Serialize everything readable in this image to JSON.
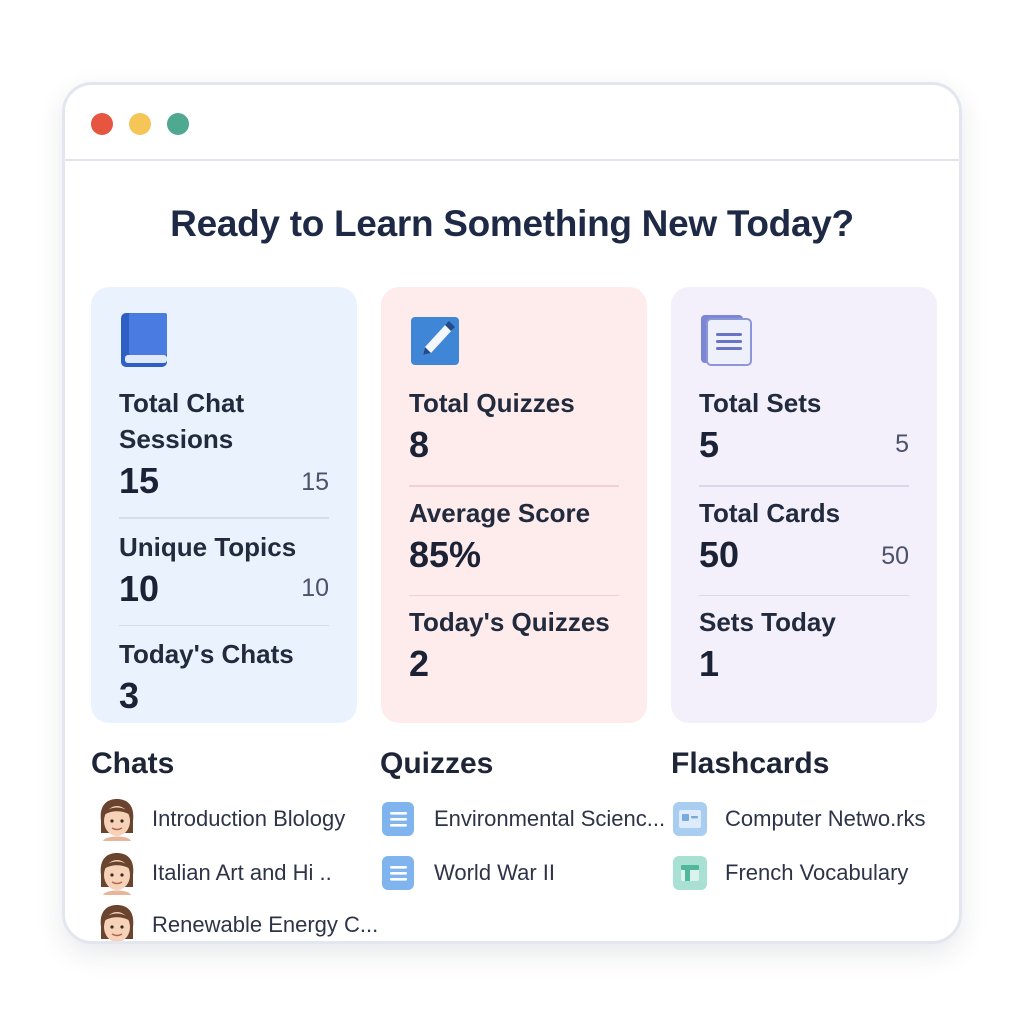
{
  "heading": "Ready to Learn Something New Today?",
  "cards": {
    "chats": {
      "icon": "book-icon",
      "color": "#eaf3fd",
      "total_label": "Total Chat Sessions",
      "total_value": "15",
      "total_side": "15",
      "unique_label": "Unique Topics",
      "unique_value": "10",
      "unique_side": "10",
      "today_label": "Today's Chats",
      "today_value": "3"
    },
    "quizzes": {
      "icon": "pencil-icon",
      "color": "#fdeceb",
      "total_label": "Total Quizzes",
      "total_value": "8",
      "avg_label": "Average Score",
      "avg_value": "85%",
      "today_label": "Today's Quizzes",
      "today_value": "2"
    },
    "flashcards": {
      "icon": "flashcard-icon",
      "color": "#f3effb",
      "sets_label": "Total Sets",
      "sets_value": "5",
      "sets_side": "5",
      "cards_label": "Total Cards",
      "cards_value": "50",
      "cards_side": "50",
      "today_label": "Sets Today",
      "today_value": "1"
    }
  },
  "sections": {
    "chats": {
      "title": "Chats",
      "items": [
        {
          "label": "Introduction Blology",
          "icon": "avatar"
        },
        {
          "label": "Italian Art and Hi ..",
          "icon": "avatar"
        },
        {
          "label": "Renewable Energy C...",
          "icon": "avatar"
        }
      ]
    },
    "quizzes": {
      "title": "Quizzes",
      "items": [
        {
          "label": "Environmental Scienc...",
          "icon": "document-icon"
        },
        {
          "label": "World War II",
          "icon": "document-icon"
        }
      ]
    },
    "flashcards": {
      "title": "Flashcards",
      "items": [
        {
          "label": "Computer Netwo.rks",
          "icon": "flashcard-deck-icon"
        },
        {
          "label": "French Vocabulary",
          "icon": "flashcard-deck-icon"
        }
      ]
    }
  }
}
